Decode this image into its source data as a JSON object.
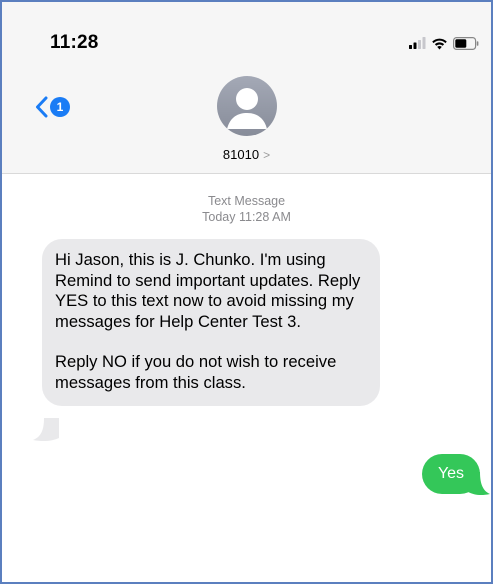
{
  "status_bar": {
    "time": "11:28",
    "icons": [
      "signal-icon",
      "wifi-icon",
      "battery-icon"
    ]
  },
  "nav": {
    "back_badge": "1",
    "contact_name": "81010",
    "contact_chevron": ">"
  },
  "conversation": {
    "service_label": "Text Message",
    "timestamp": "Today 11:28 AM",
    "messages": [
      {
        "direction": "incoming",
        "paragraphs": [
          "Hi Jason, this is J. Chunko. I'm using Remind to send important updates. Reply YES to this text now to avoid missing my messages for Help Center Test 3.",
          "Reply NO if you do not wish to receive messages from this class."
        ]
      },
      {
        "direction": "outgoing",
        "text": "Yes"
      }
    ]
  },
  "colors": {
    "accent": "#1a7cf5",
    "incoming_bubble": "#e9e9eb",
    "outgoing_bubble": "#34c759",
    "header_bg": "#f6f6f6",
    "meta_text": "#8a8a8e"
  }
}
